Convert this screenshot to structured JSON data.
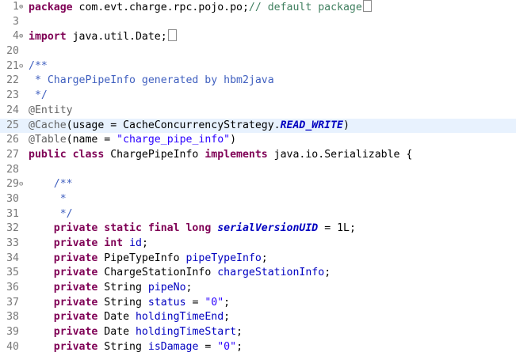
{
  "lines": [
    {
      "n": "1",
      "fold": "⊕",
      "tokens": [
        {
          "t": "package",
          "c": "kw"
        },
        {
          "t": " com.evt.charge.rpc.pojo.po;",
          "c": ""
        },
        {
          "t": "// default package",
          "c": "cmt"
        }
      ],
      "box": true
    },
    {
      "n": "3",
      "fold": "",
      "tokens": []
    },
    {
      "n": "4",
      "fold": "⊕",
      "tokens": [
        {
          "t": "import",
          "c": "kw"
        },
        {
          "t": " java.util.Date;",
          "c": ""
        }
      ],
      "box": true
    },
    {
      "n": "20",
      "fold": "",
      "tokens": []
    },
    {
      "n": "21",
      "fold": "⊖",
      "tokens": [
        {
          "t": "/**",
          "c": "jd"
        }
      ]
    },
    {
      "n": "22",
      "fold": "",
      "tokens": [
        {
          "t": " * ChargePipeInfo generated by hbm2java",
          "c": "jd"
        }
      ]
    },
    {
      "n": "23",
      "fold": "",
      "tokens": [
        {
          "t": " */",
          "c": "jd"
        }
      ]
    },
    {
      "n": "24",
      "fold": "",
      "tokens": [
        {
          "t": "@Entity",
          "c": "ann"
        }
      ]
    },
    {
      "n": "25",
      "fold": "",
      "highlight": true,
      "tokens": [
        {
          "t": "@Cache",
          "c": "ann"
        },
        {
          "t": "(usage = CacheConcurrencyStrategy.",
          "c": ""
        },
        {
          "t": "READ_WRITE",
          "c": "enumc"
        },
        {
          "t": ")",
          "c": ""
        }
      ]
    },
    {
      "n": "26",
      "fold": "",
      "tokens": [
        {
          "t": "@Table",
          "c": "ann"
        },
        {
          "t": "(name = ",
          "c": ""
        },
        {
          "t": "\"charge_pipe_info\"",
          "c": "str"
        },
        {
          "t": ")",
          "c": ""
        }
      ]
    },
    {
      "n": "27",
      "fold": "",
      "tokens": [
        {
          "t": "public class",
          "c": "kw"
        },
        {
          "t": " ChargePipeInfo ",
          "c": ""
        },
        {
          "t": "implements",
          "c": "kw"
        },
        {
          "t": " java.io.Serializable {",
          "c": ""
        }
      ]
    },
    {
      "n": "28",
      "fold": "",
      "tokens": []
    },
    {
      "n": "29",
      "fold": "⊖",
      "tokens": [
        {
          "t": "    /**",
          "c": "jd"
        }
      ]
    },
    {
      "n": "30",
      "fold": "",
      "tokens": [
        {
          "t": "     *",
          "c": "jd"
        }
      ]
    },
    {
      "n": "31",
      "fold": "",
      "tokens": [
        {
          "t": "     */",
          "c": "jd"
        }
      ]
    },
    {
      "n": "32",
      "fold": "",
      "tokens": [
        {
          "t": "    ",
          "c": ""
        },
        {
          "t": "private static final long",
          "c": "kw"
        },
        {
          "t": " ",
          "c": ""
        },
        {
          "t": "serialVersionUID",
          "c": "stfld"
        },
        {
          "t": " = 1L;",
          "c": ""
        }
      ]
    },
    {
      "n": "33",
      "fold": "",
      "tokens": [
        {
          "t": "    ",
          "c": ""
        },
        {
          "t": "private int",
          "c": "kw"
        },
        {
          "t": " ",
          "c": ""
        },
        {
          "t": "id",
          "c": "fld"
        },
        {
          "t": ";",
          "c": ""
        }
      ]
    },
    {
      "n": "34",
      "fold": "",
      "tokens": [
        {
          "t": "    ",
          "c": ""
        },
        {
          "t": "private",
          "c": "kw"
        },
        {
          "t": " PipeTypeInfo ",
          "c": ""
        },
        {
          "t": "pipeTypeInfo",
          "c": "fld"
        },
        {
          "t": ";",
          "c": ""
        }
      ]
    },
    {
      "n": "35",
      "fold": "",
      "tokens": [
        {
          "t": "    ",
          "c": ""
        },
        {
          "t": "private",
          "c": "kw"
        },
        {
          "t": " ChargeStationInfo ",
          "c": ""
        },
        {
          "t": "chargeStationInfo",
          "c": "fld"
        },
        {
          "t": ";",
          "c": ""
        }
      ]
    },
    {
      "n": "36",
      "fold": "",
      "tokens": [
        {
          "t": "    ",
          "c": ""
        },
        {
          "t": "private",
          "c": "kw"
        },
        {
          "t": " String ",
          "c": ""
        },
        {
          "t": "pipeNo",
          "c": "fld"
        },
        {
          "t": ";",
          "c": ""
        }
      ]
    },
    {
      "n": "37",
      "fold": "",
      "tokens": [
        {
          "t": "    ",
          "c": ""
        },
        {
          "t": "private",
          "c": "kw"
        },
        {
          "t": " String ",
          "c": ""
        },
        {
          "t": "status",
          "c": "fld"
        },
        {
          "t": " = ",
          "c": ""
        },
        {
          "t": "\"0\"",
          "c": "str"
        },
        {
          "t": ";",
          "c": ""
        }
      ]
    },
    {
      "n": "38",
      "fold": "",
      "tokens": [
        {
          "t": "    ",
          "c": ""
        },
        {
          "t": "private",
          "c": "kw"
        },
        {
          "t": " Date ",
          "c": ""
        },
        {
          "t": "holdingTimeEnd",
          "c": "fld"
        },
        {
          "t": ";",
          "c": ""
        }
      ]
    },
    {
      "n": "39",
      "fold": "",
      "tokens": [
        {
          "t": "    ",
          "c": ""
        },
        {
          "t": "private",
          "c": "kw"
        },
        {
          "t": " Date ",
          "c": ""
        },
        {
          "t": "holdingTimeStart",
          "c": "fld"
        },
        {
          "t": ";",
          "c": ""
        }
      ]
    },
    {
      "n": "40",
      "fold": "",
      "tokens": [
        {
          "t": "    ",
          "c": ""
        },
        {
          "t": "private",
          "c": "kw"
        },
        {
          "t": " String ",
          "c": ""
        },
        {
          "t": "isDamage",
          "c": "fld"
        },
        {
          "t": " = ",
          "c": ""
        },
        {
          "t": "\"0\"",
          "c": "str"
        },
        {
          "t": ";",
          "c": ""
        }
      ]
    }
  ]
}
